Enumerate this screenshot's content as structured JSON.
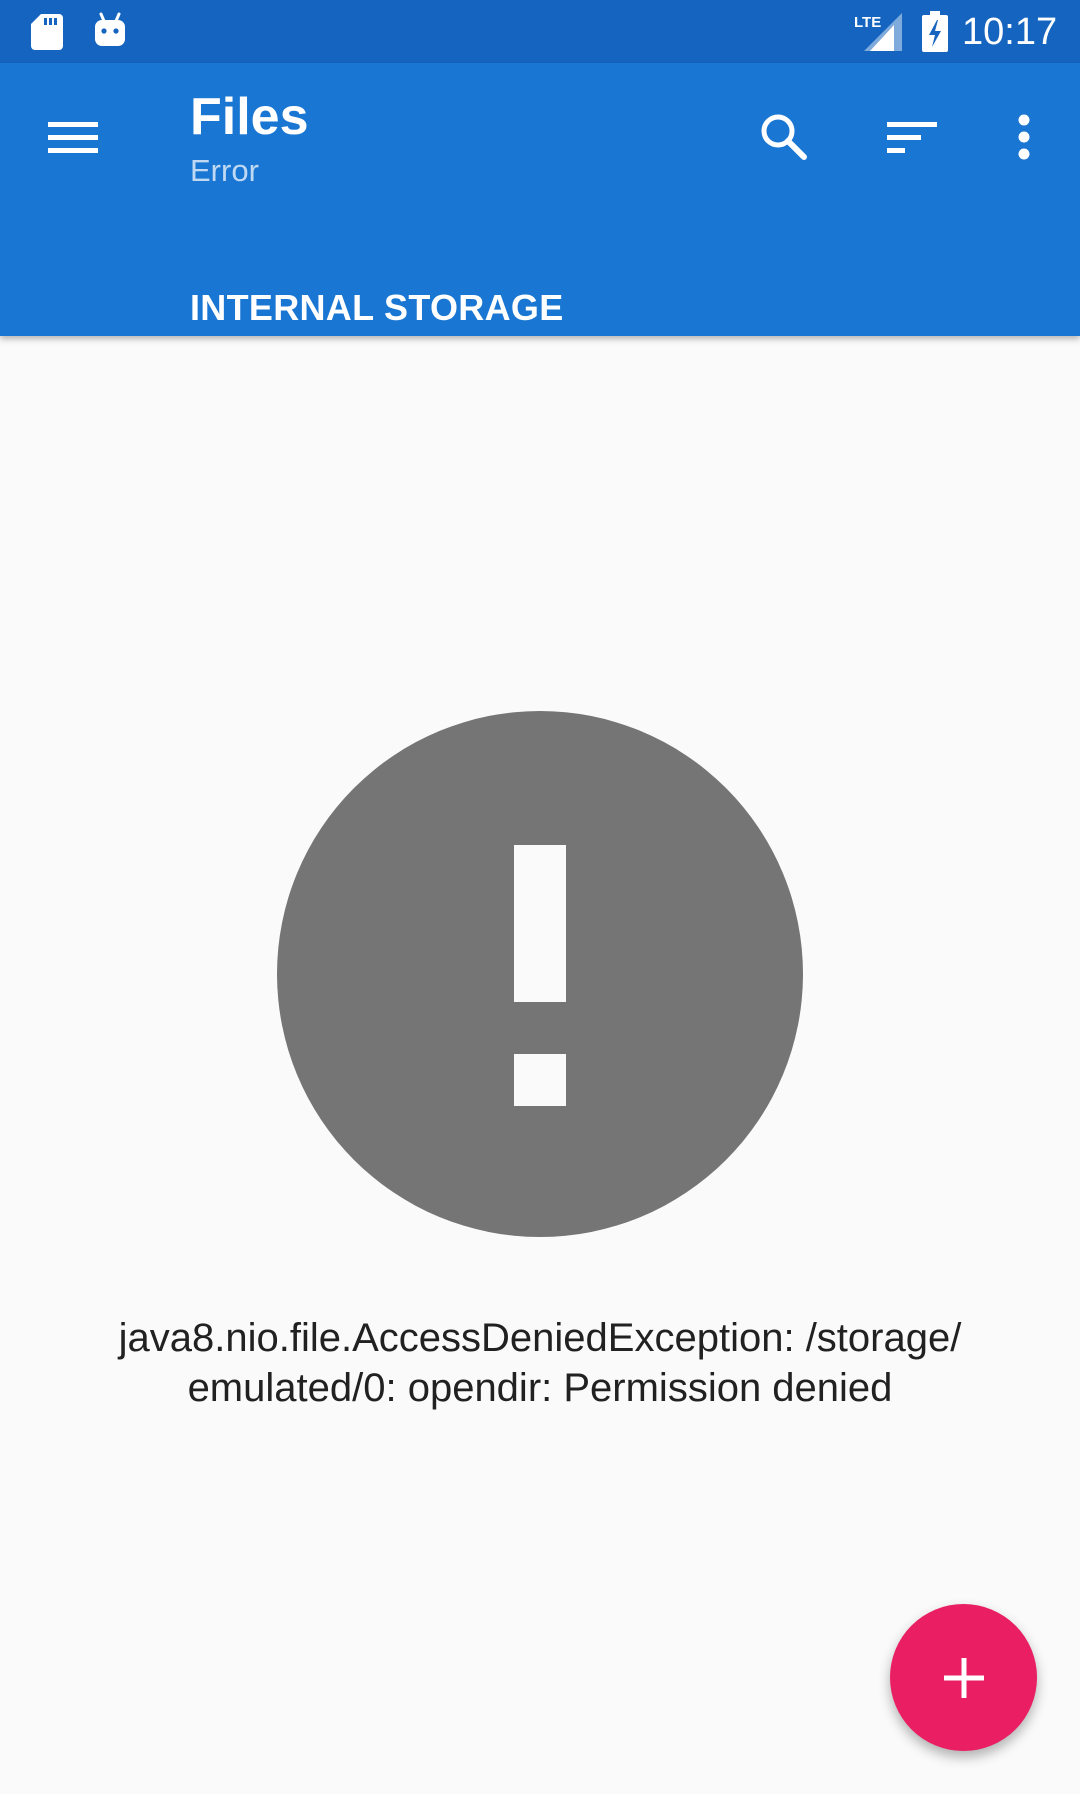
{
  "status_bar": {
    "time": "10:17",
    "network_label": "LTE",
    "icons": [
      "sd-card-icon",
      "android-bot-icon",
      "lte-signal-icon",
      "battery-charging-icon"
    ]
  },
  "app_bar": {
    "title": "Files",
    "subtitle": "Error",
    "breadcrumb": "INTERNAL STORAGE",
    "actions": [
      "menu-icon",
      "search-icon",
      "sort-icon",
      "more-vert-icon"
    ],
    "color": "#1976d2",
    "status_bar_color": "#1565c0"
  },
  "content": {
    "error_icon": "error-icon",
    "error_icon_color": "#757575",
    "error_message": "java8.nio.file.AccessDeniedException: /storage/ emulated/0: opendir: Permission denied"
  },
  "fab": {
    "icon": "add-icon",
    "color": "#e91e63"
  }
}
